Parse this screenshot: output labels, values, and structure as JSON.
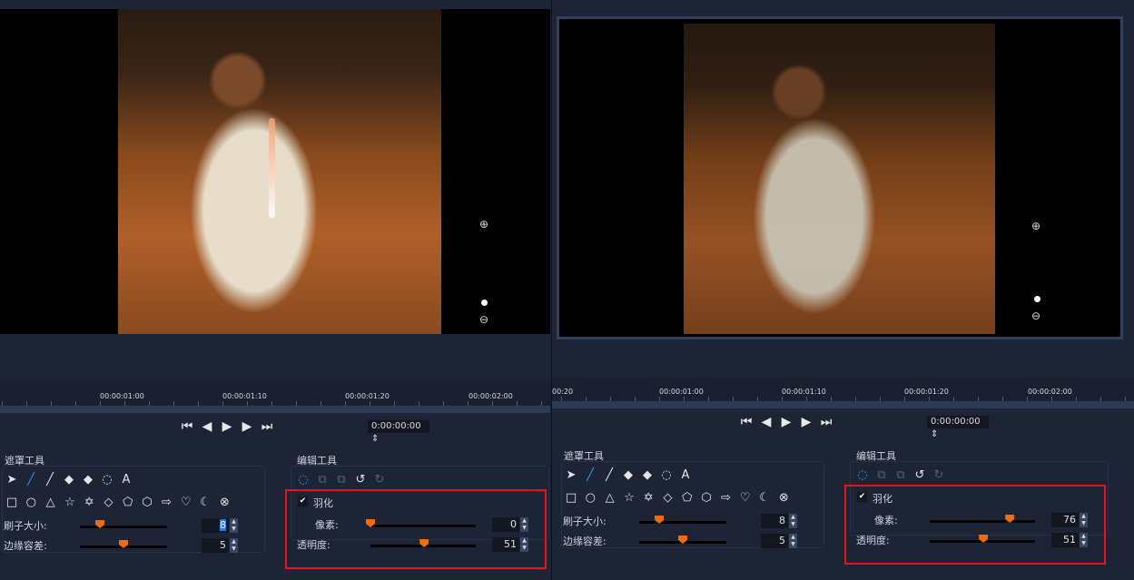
{
  "panels": [
    {
      "ruler": [
        "00:00:01:00",
        "00:00:01:10",
        "00:00:01:20",
        "00:00:02:00"
      ],
      "timecode": "0:00:00:00",
      "mask_tools": {
        "title": "遮罩工具",
        "brush_size_label": "刷子大小:",
        "edge_tolerance_label": "边缘容差:",
        "brush_size": "8",
        "edge_tolerance": "5",
        "brush_size_fill": 0.23,
        "edge_tolerance_fill": 0.5,
        "brush_size_selected": true
      },
      "edit_tools": {
        "title": "编辑工具",
        "feather_label": "羽化",
        "feather_checked": true,
        "pixels_label": "像素:",
        "opacity_label": "透明度:",
        "pixels": "0",
        "opacity": "51",
        "pixels_fill": 0.0,
        "opacity_fill": 0.51
      }
    },
    {
      "ruler": [
        "00:20",
        "00:00:01:00",
        "00:00:01:10",
        "00:00:01:20",
        "00:00:02:00"
      ],
      "timecode": "0:00:00:00",
      "mask_tools": {
        "title": "遮罩工具",
        "brush_size_label": "刷子大小:",
        "edge_tolerance_label": "边缘容差:",
        "brush_size": "8",
        "edge_tolerance": "5",
        "brush_size_fill": 0.23,
        "edge_tolerance_fill": 0.5,
        "brush_size_selected": false
      },
      "edit_tools": {
        "title": "编辑工具",
        "feather_label": "羽化",
        "feather_checked": true,
        "pixels_label": "像素:",
        "opacity_label": "透明度:",
        "pixels": "76",
        "opacity": "51",
        "pixels_fill": 0.76,
        "opacity_fill": 0.51
      }
    }
  ],
  "icons": {
    "mask_row1": [
      "pointer-icon",
      "brush-icon",
      "smart-brush-icon",
      "eraser-icon",
      "smart-eraser-icon",
      "lasso-icon",
      "text-icon"
    ],
    "mask_row1_glyphs": [
      "➤",
      "╱",
      "╱",
      "◆",
      "◆",
      "◌",
      "A"
    ],
    "mask_row2": [
      "rectangle-icon",
      "ellipse-icon",
      "triangle-icon",
      "star-icon",
      "hexagram-icon",
      "diamond-icon",
      "pentagon-icon",
      "hexagon-icon",
      "arrow-icon",
      "heart-icon",
      "crescent-icon",
      "clear-icon"
    ],
    "mask_row2_glyphs": [
      "□",
      "○",
      "△",
      "☆",
      "✡",
      "◇",
      "⬠",
      "⬡",
      "⇨",
      "♡",
      "☾",
      "⊗"
    ],
    "edit_row": [
      "lasso-select-icon",
      "copy-icon",
      "paste-icon",
      "undo-icon",
      "redo-icon"
    ],
    "edit_row_glyphs": [
      "◌",
      "⧉",
      "⧉",
      "↺",
      "↻"
    ],
    "transport": [
      "go-start-icon",
      "prev-frame-icon",
      "play-icon",
      "next-frame-icon",
      "go-end-icon"
    ],
    "transport_glyphs": [
      "⏮",
      "◀",
      "▶",
      "▶",
      "⏭"
    ]
  },
  "colors": {
    "accent": "#f06a10",
    "highlight": "#e8141a",
    "selected": "#2a78d8"
  }
}
